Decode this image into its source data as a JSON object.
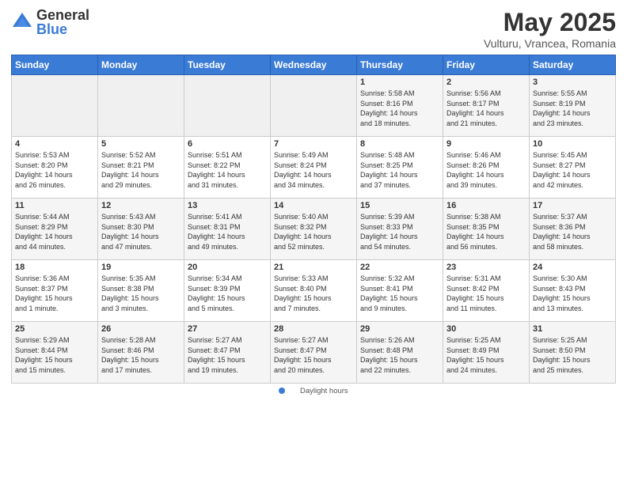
{
  "header": {
    "logo_general": "General",
    "logo_blue": "Blue",
    "month_title": "May 2025",
    "location": "Vulturu, Vrancea, Romania"
  },
  "legend": {
    "daylight_label": "Daylight hours"
  },
  "weekdays": [
    "Sunday",
    "Monday",
    "Tuesday",
    "Wednesday",
    "Thursday",
    "Friday",
    "Saturday"
  ],
  "weeks": [
    [
      {
        "day": "",
        "info": ""
      },
      {
        "day": "",
        "info": ""
      },
      {
        "day": "",
        "info": ""
      },
      {
        "day": "",
        "info": ""
      },
      {
        "day": "1",
        "info": "Sunrise: 5:58 AM\nSunset: 8:16 PM\nDaylight: 14 hours\nand 18 minutes."
      },
      {
        "day": "2",
        "info": "Sunrise: 5:56 AM\nSunset: 8:17 PM\nDaylight: 14 hours\nand 21 minutes."
      },
      {
        "day": "3",
        "info": "Sunrise: 5:55 AM\nSunset: 8:19 PM\nDaylight: 14 hours\nand 23 minutes."
      }
    ],
    [
      {
        "day": "4",
        "info": "Sunrise: 5:53 AM\nSunset: 8:20 PM\nDaylight: 14 hours\nand 26 minutes."
      },
      {
        "day": "5",
        "info": "Sunrise: 5:52 AM\nSunset: 8:21 PM\nDaylight: 14 hours\nand 29 minutes."
      },
      {
        "day": "6",
        "info": "Sunrise: 5:51 AM\nSunset: 8:22 PM\nDaylight: 14 hours\nand 31 minutes."
      },
      {
        "day": "7",
        "info": "Sunrise: 5:49 AM\nSunset: 8:24 PM\nDaylight: 14 hours\nand 34 minutes."
      },
      {
        "day": "8",
        "info": "Sunrise: 5:48 AM\nSunset: 8:25 PM\nDaylight: 14 hours\nand 37 minutes."
      },
      {
        "day": "9",
        "info": "Sunrise: 5:46 AM\nSunset: 8:26 PM\nDaylight: 14 hours\nand 39 minutes."
      },
      {
        "day": "10",
        "info": "Sunrise: 5:45 AM\nSunset: 8:27 PM\nDaylight: 14 hours\nand 42 minutes."
      }
    ],
    [
      {
        "day": "11",
        "info": "Sunrise: 5:44 AM\nSunset: 8:29 PM\nDaylight: 14 hours\nand 44 minutes."
      },
      {
        "day": "12",
        "info": "Sunrise: 5:43 AM\nSunset: 8:30 PM\nDaylight: 14 hours\nand 47 minutes."
      },
      {
        "day": "13",
        "info": "Sunrise: 5:41 AM\nSunset: 8:31 PM\nDaylight: 14 hours\nand 49 minutes."
      },
      {
        "day": "14",
        "info": "Sunrise: 5:40 AM\nSunset: 8:32 PM\nDaylight: 14 hours\nand 52 minutes."
      },
      {
        "day": "15",
        "info": "Sunrise: 5:39 AM\nSunset: 8:33 PM\nDaylight: 14 hours\nand 54 minutes."
      },
      {
        "day": "16",
        "info": "Sunrise: 5:38 AM\nSunset: 8:35 PM\nDaylight: 14 hours\nand 56 minutes."
      },
      {
        "day": "17",
        "info": "Sunrise: 5:37 AM\nSunset: 8:36 PM\nDaylight: 14 hours\nand 58 minutes."
      }
    ],
    [
      {
        "day": "18",
        "info": "Sunrise: 5:36 AM\nSunset: 8:37 PM\nDaylight: 15 hours\nand 1 minute."
      },
      {
        "day": "19",
        "info": "Sunrise: 5:35 AM\nSunset: 8:38 PM\nDaylight: 15 hours\nand 3 minutes."
      },
      {
        "day": "20",
        "info": "Sunrise: 5:34 AM\nSunset: 8:39 PM\nDaylight: 15 hours\nand 5 minutes."
      },
      {
        "day": "21",
        "info": "Sunrise: 5:33 AM\nSunset: 8:40 PM\nDaylight: 15 hours\nand 7 minutes."
      },
      {
        "day": "22",
        "info": "Sunrise: 5:32 AM\nSunset: 8:41 PM\nDaylight: 15 hours\nand 9 minutes."
      },
      {
        "day": "23",
        "info": "Sunrise: 5:31 AM\nSunset: 8:42 PM\nDaylight: 15 hours\nand 11 minutes."
      },
      {
        "day": "24",
        "info": "Sunrise: 5:30 AM\nSunset: 8:43 PM\nDaylight: 15 hours\nand 13 minutes."
      }
    ],
    [
      {
        "day": "25",
        "info": "Sunrise: 5:29 AM\nSunset: 8:44 PM\nDaylight: 15 hours\nand 15 minutes."
      },
      {
        "day": "26",
        "info": "Sunrise: 5:28 AM\nSunset: 8:46 PM\nDaylight: 15 hours\nand 17 minutes."
      },
      {
        "day": "27",
        "info": "Sunrise: 5:27 AM\nSunset: 8:47 PM\nDaylight: 15 hours\nand 19 minutes."
      },
      {
        "day": "28",
        "info": "Sunrise: 5:27 AM\nSunset: 8:47 PM\nDaylight: 15 hours\nand 20 minutes."
      },
      {
        "day": "29",
        "info": "Sunrise: 5:26 AM\nSunset: 8:48 PM\nDaylight: 15 hours\nand 22 minutes."
      },
      {
        "day": "30",
        "info": "Sunrise: 5:25 AM\nSunset: 8:49 PM\nDaylight: 15 hours\nand 24 minutes."
      },
      {
        "day": "31",
        "info": "Sunrise: 5:25 AM\nSunset: 8:50 PM\nDaylight: 15 hours\nand 25 minutes."
      }
    ]
  ]
}
